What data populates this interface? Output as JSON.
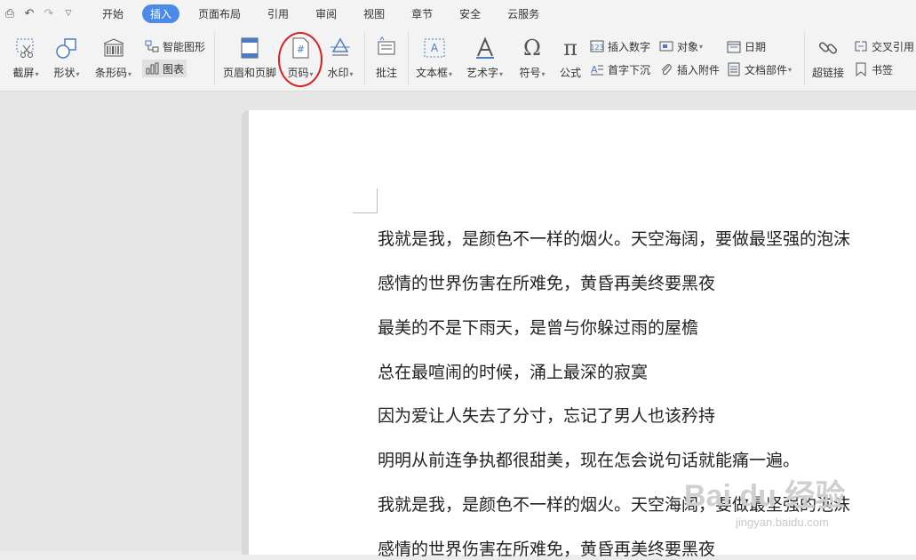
{
  "menu": {
    "tabs": [
      "开始",
      "插入",
      "页面布局",
      "引用",
      "审阅",
      "视图",
      "章节",
      "安全",
      "云服务"
    ],
    "active_index": 1
  },
  "ribbon": {
    "screenshot": "截屏",
    "shape": "形状",
    "barcode": "条形码",
    "smart_graphic": "智能图形",
    "chart": "图表",
    "header_footer": "页眉和页脚",
    "page_number": "页码",
    "watermark": "水印",
    "comment": "批注",
    "textbox": "文本框",
    "wordart": "艺术字",
    "symbol": "符号",
    "formula": "公式",
    "insert_number": "插入数字",
    "drop_cap": "首字下沉",
    "object": "对象",
    "attachment": "插入附件",
    "date": "日期",
    "doc_parts": "文档部件",
    "hyperlink": "超链接",
    "cross_ref": "交叉引用",
    "bookmark": "书签"
  },
  "document": {
    "lines": [
      "我就是我，是颜色不一样的烟火。天空海阔，要做最坚强的泡沫",
      "感情的世界伤害在所难免，黄昏再美终要黑夜",
      "最美的不是下雨天，是曾与你躲过雨的屋檐",
      "总在最喧闹的时候，涌上最深的寂寞",
      "因为爱让人失去了分寸，忘记了男人也该矜持",
      "明明从前连争执都很甜美，现在怎会说句话就能痛一遍。",
      "我就是我，是颜色不一样的烟火。天空海阔，要做最坚强的泡沫",
      "感情的世界伤害在所难免，黄昏再美终要黑夜"
    ]
  },
  "watermark": {
    "brand": "Bai du 经验",
    "url": "jingyan.baidu.com"
  },
  "colors": {
    "accent": "#4a8be8",
    "highlight_circle": "#d81e1e"
  }
}
